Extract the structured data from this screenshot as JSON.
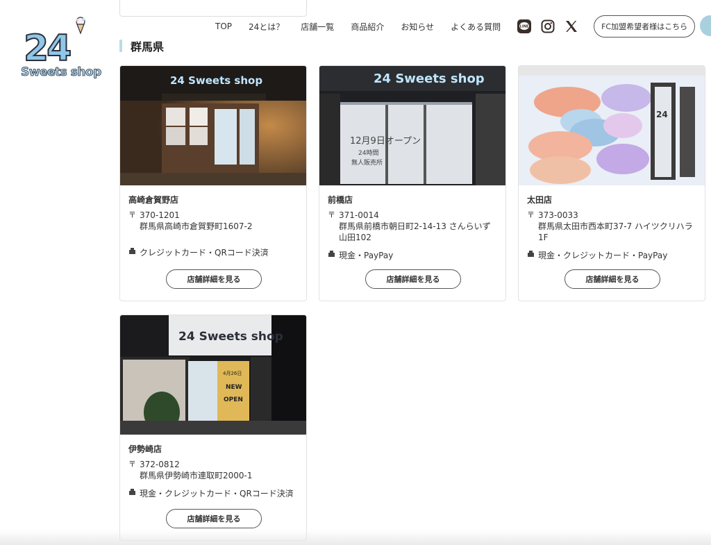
{
  "logo": {
    "number": "24",
    "text": "Sweets shop"
  },
  "nav": {
    "items": [
      "TOP",
      "24とは？",
      "店舗一覧",
      "商品紹介",
      "お知らせ",
      "よくある質問"
    ],
    "line_label": "LINE",
    "fc_button": "FC加盟希望者様はこちら"
  },
  "section": {
    "title": "群馬県"
  },
  "detail_button": "店舗詳細を見る",
  "icons": {
    "postal": "〒",
    "payment": "payment-icon"
  },
  "photo_signs": {
    "takasaki": "24 Sweets shop",
    "maebashi": "24 Sweets shop",
    "maebashi_window_1": "12月9日オープン",
    "maebashi_window_2": "24時間",
    "maebashi_window_3": "無人販売所",
    "ota": "24",
    "isesaki": "24 Sweets shop",
    "isesaki_window_1": "4月26日",
    "isesaki_window_2": "NEW",
    "isesaki_window_3": "OPEN"
  },
  "stores": [
    {
      "name": "高崎倉賀野店",
      "postal": "370-1201",
      "address": "群馬県高崎市倉賀野町1607-2",
      "payment": "クレジットカード・QRコード決済"
    },
    {
      "name": "前橋店",
      "postal": "371-0014",
      "address": "群馬県前橋市朝日町2-14-13 さんらいず山田102",
      "payment": "現金・PayPay"
    },
    {
      "name": "太田店",
      "postal": "373-0033",
      "address": "群馬県太田市西本町37-7 ハイツクリハラ1F",
      "payment": "現金・クレジットカード・PayPay"
    },
    {
      "name": "伊勢崎店",
      "postal": "372-0812",
      "address": "群馬県伊勢崎市連取町2000-1",
      "payment": "現金・クレジットカード・QRコード決済"
    }
  ],
  "colors": {
    "accent": "#b9dce6",
    "logo_blue": "#8fc7e8",
    "text": "#333333"
  }
}
